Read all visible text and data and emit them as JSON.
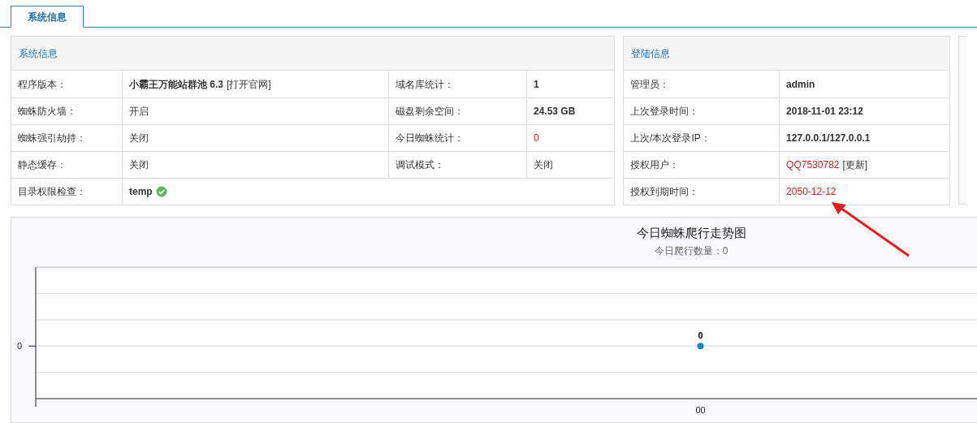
{
  "tabs": [
    {
      "label": "系统信息",
      "selected": true
    }
  ],
  "system_panel": {
    "title": "系统信息",
    "rows": [
      [
        {
          "label": "程序版本：",
          "value": {
            "text": "小霸王万能站群池 6.3",
            "bold": true,
            "alert": false,
            "link": "[打开官网]"
          }
        },
        {
          "label": "域名库统计：",
          "value": {
            "text": "1",
            "bold": true,
            "alert": false
          }
        }
      ],
      [
        {
          "label": "蜘蛛防火墙：",
          "value": {
            "text": "开启",
            "bold": false,
            "alert": false
          }
        },
        {
          "label": "磁盘剩余空间：",
          "value": {
            "text": "24.53 GB",
            "bold": true,
            "alert": false
          }
        }
      ],
      [
        {
          "label": "蜘蛛强引劫持：",
          "value": {
            "text": "关闭",
            "bold": false,
            "alert": false
          }
        },
        {
          "label": "今日蜘蛛统计：",
          "value": {
            "text": "0",
            "bold": false,
            "alert": true
          }
        }
      ],
      [
        {
          "label": "静态缓存：",
          "value": {
            "text": "关闭",
            "bold": false,
            "alert": false
          }
        },
        {
          "label": "调试模式：",
          "value": {
            "text": "关闭",
            "bold": false,
            "alert": false
          }
        }
      ],
      [
        {
          "label": "目录权限检查：",
          "value": {
            "text": "temp",
            "bold": true,
            "alert": false,
            "ok": true
          }
        }
      ]
    ]
  },
  "login_panel": {
    "title": "登陆信息",
    "rows": [
      {
        "label": "管理员：",
        "value": {
          "text": "admin",
          "bold": true,
          "alert": false
        }
      },
      {
        "label": "上次登录时间：",
        "value": {
          "text": "2018-11-01 23:12",
          "bold": true,
          "alert": false
        }
      },
      {
        "label": "上次/本次登录IP：",
        "value": {
          "text": "127.0.0.1/127.0.0.1",
          "bold": true,
          "alert": false
        }
      },
      {
        "label": "授权用户：",
        "value": {
          "text": "QQ7530782",
          "bold": false,
          "alert": true,
          "link": "[更新]"
        }
      },
      {
        "label": "授权到期时间：",
        "value": {
          "text": "2050-12-12",
          "bold": false,
          "alert": true
        }
      }
    ]
  },
  "chart_panel": {
    "title": "今日蜘蛛爬行走势图",
    "subtitle": "今日爬行数量：0",
    "y_axis_tick": "0",
    "x_axis_label": "00",
    "point_label": "0"
  }
}
